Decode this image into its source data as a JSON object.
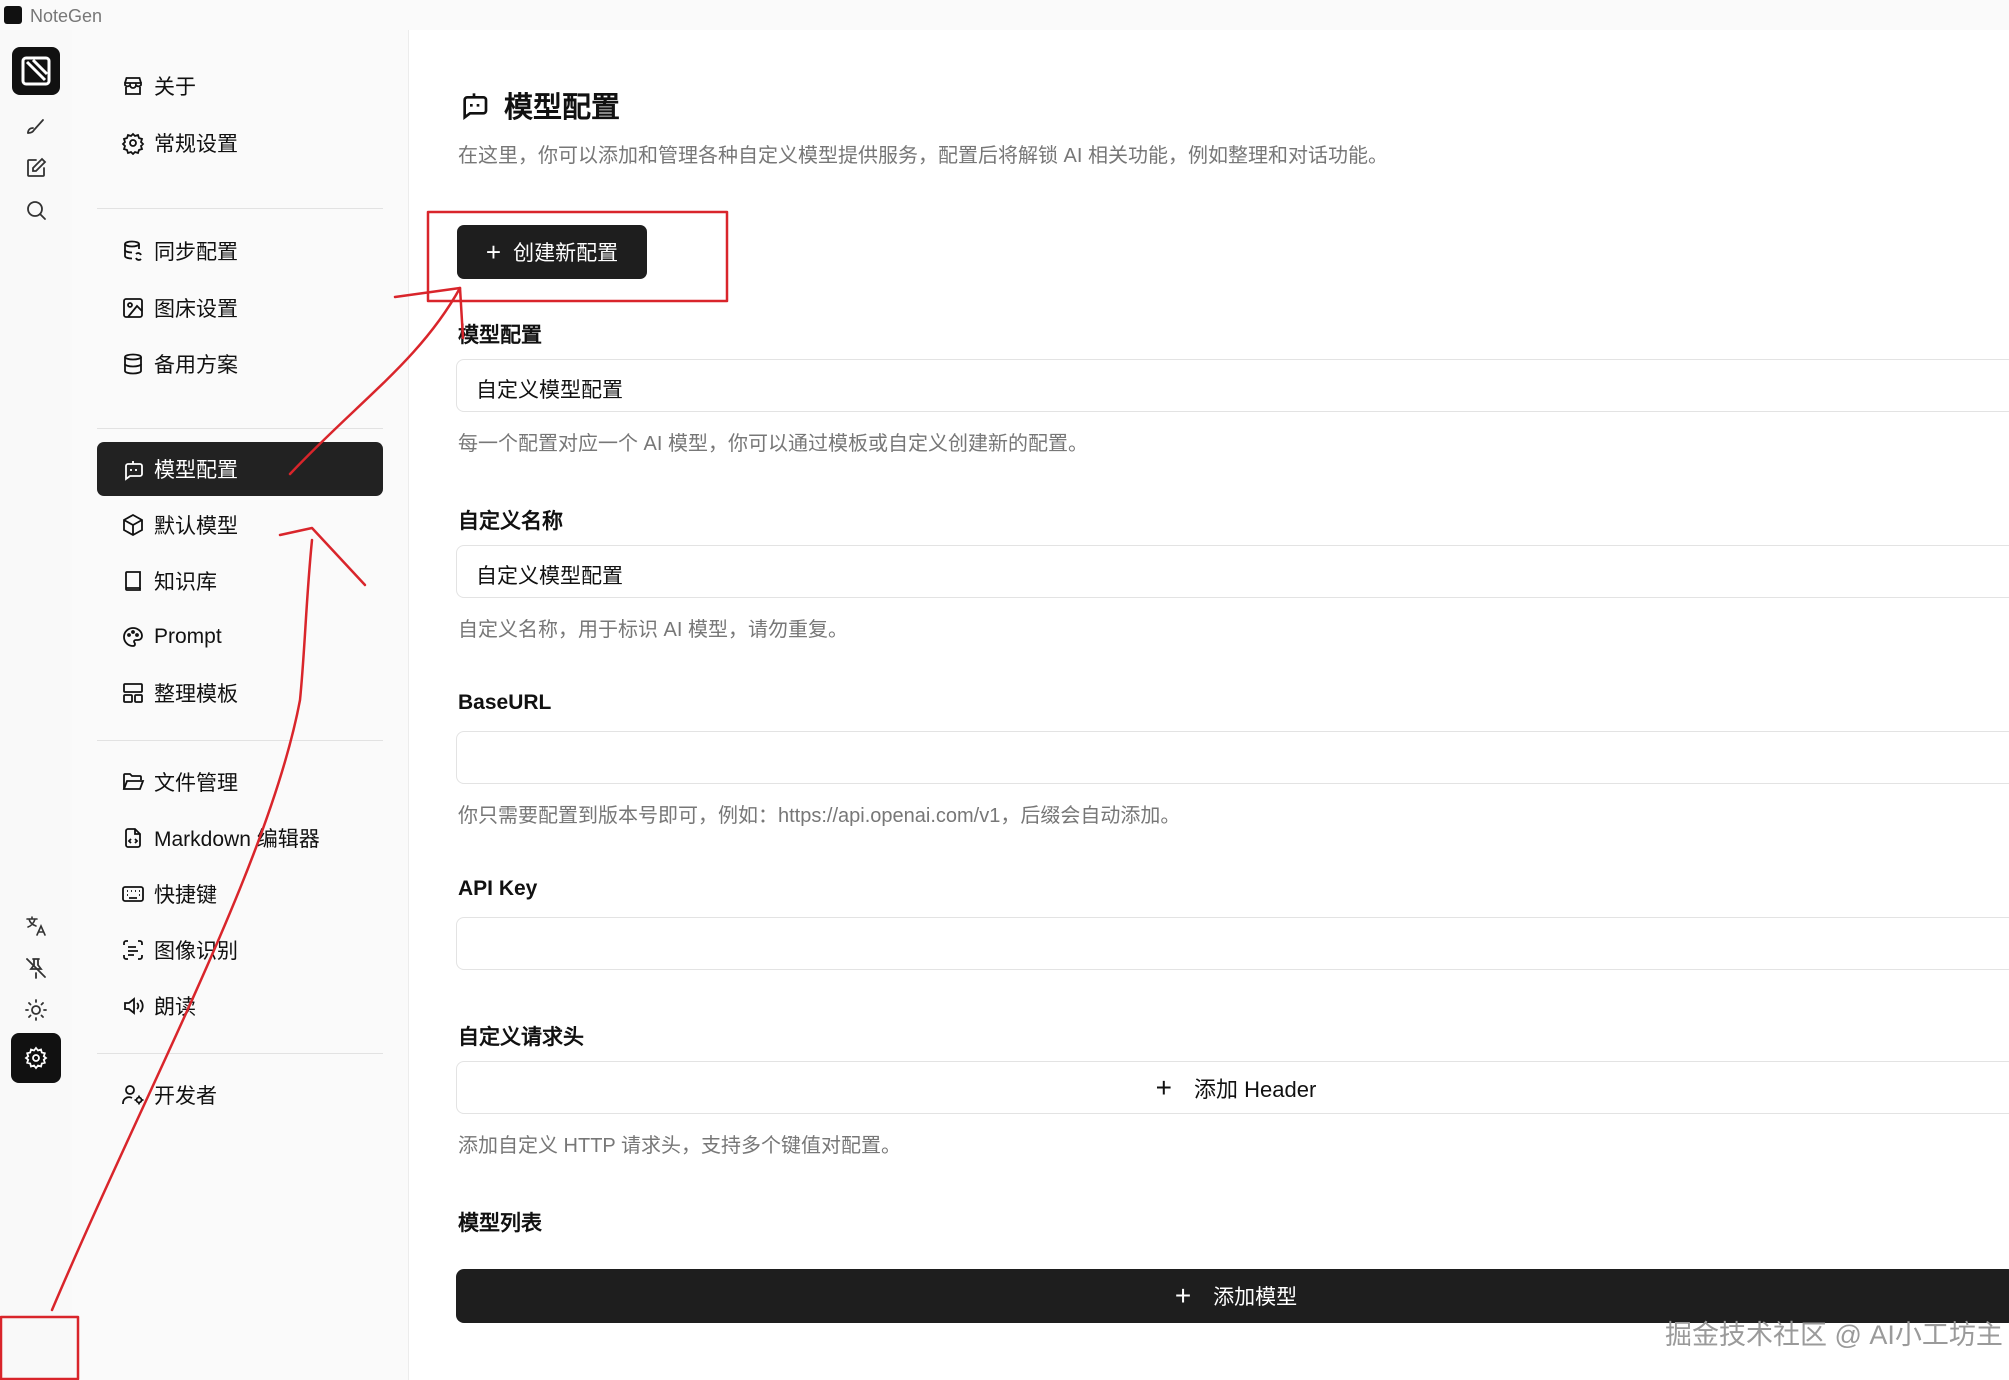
{
  "app": {
    "name": "NoteGen"
  },
  "rail": {
    "top_icons": [
      "brush-icon",
      "edit-icon",
      "search-icon"
    ],
    "bottom_icons": [
      "translate-icon",
      "pin-off-icon",
      "sun-icon",
      "settings-icon"
    ]
  },
  "nav": {
    "groups": [
      [
        {
          "label": "关于",
          "icon": "store-icon"
        },
        {
          "label": "常规设置",
          "icon": "gear-icon"
        }
      ],
      [
        {
          "label": "同步配置",
          "icon": "database-sync-icon"
        },
        {
          "label": "图床设置",
          "icon": "image-upload-icon"
        },
        {
          "label": "备用方案",
          "icon": "database-icon"
        }
      ],
      [
        {
          "label": "模型配置",
          "icon": "bot-icon",
          "active": true
        },
        {
          "label": "默认模型",
          "icon": "box-icon"
        },
        {
          "label": "知识库",
          "icon": "book-icon"
        },
        {
          "label": "Prompt",
          "icon": "palette-icon"
        },
        {
          "label": "整理模板",
          "icon": "layout-icon"
        }
      ],
      [
        {
          "label": "文件管理",
          "icon": "folder-open-icon"
        },
        {
          "label": "Markdown 编辑器",
          "icon": "file-code-icon"
        },
        {
          "label": "快捷键",
          "icon": "keyboard-icon"
        },
        {
          "label": "图像识别",
          "icon": "scan-text-icon"
        },
        {
          "label": "朗读",
          "icon": "volume-icon"
        }
      ],
      [
        {
          "label": "开发者",
          "icon": "user-cog-icon"
        }
      ]
    ]
  },
  "main": {
    "title": "模型配置",
    "description": "在这里，你可以添加和管理各种自定义模型提供服务，配置后将解锁 AI 相关功能，例如整理和对话功能。",
    "create_button": "创建新配置",
    "fields": {
      "model_config": {
        "label": "模型配置",
        "value": "自定义模型配置",
        "help": "每一个配置对应一个 AI 模型，你可以通过模板或自定义创建新的配置。"
      },
      "custom_name": {
        "label": "自定义名称",
        "value": "自定义模型配置",
        "help": "自定义名称，用于标识 AI 模型，请勿重复。"
      },
      "base_url": {
        "label": "BaseURL",
        "value": "",
        "help": "你只需要配置到版本号即可，例如：https://api.openai.com/v1，后缀会自动添加。"
      },
      "api_key": {
        "label": "API Key",
        "value": ""
      },
      "headers": {
        "label": "自定义请求头",
        "add_label": "添加 Header",
        "help": "添加自定义 HTTP 请求头，支持多个键值对配置。"
      },
      "model_list": {
        "label": "模型列表",
        "add_label": "添加模型"
      }
    }
  },
  "watermark": "掘金技术社区 @ AI小工坊主",
  "annotation_color": "#d9252b"
}
